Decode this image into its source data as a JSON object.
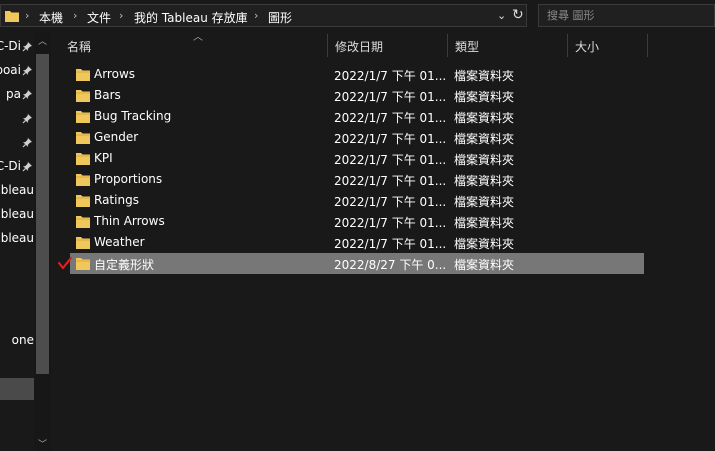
{
  "address": {
    "crumbs": [
      "本機",
      "文件",
      "我的 Tableau 存放庫",
      "圖形"
    ],
    "dropdown_glyph": "⌄",
    "refresh_glyph": "↻"
  },
  "search": {
    "placeholder": "搜尋 圖形"
  },
  "nav": {
    "items": [
      {
        "label": "C-Di",
        "pinned": true
      },
      {
        "label": "boai",
        "pinned": true
      },
      {
        "label": "pa",
        "pinned": true
      },
      {
        "label": "",
        "pinned": true
      },
      {
        "label": "",
        "pinned": true
      },
      {
        "label": "C-Di",
        "pinned": true
      },
      {
        "label": "ableau",
        "pinned": false
      },
      {
        "label": "ableau",
        "pinned": false
      },
      {
        "label": "ableau",
        "pinned": false
      },
      {
        "label": "one",
        "pinned": false
      }
    ]
  },
  "columns": {
    "name": "名稱",
    "date": "修改日期",
    "type": "類型",
    "size": "大小"
  },
  "files": [
    {
      "name": "Arrows",
      "date": "2022/1/7 下午 01...",
      "type": "檔案資料夾",
      "selected": false
    },
    {
      "name": "Bars",
      "date": "2022/1/7 下午 01...",
      "type": "檔案資料夾",
      "selected": false
    },
    {
      "name": "Bug Tracking",
      "date": "2022/1/7 下午 01...",
      "type": "檔案資料夾",
      "selected": false
    },
    {
      "name": "Gender",
      "date": "2022/1/7 下午 01...",
      "type": "檔案資料夾",
      "selected": false
    },
    {
      "name": "KPI",
      "date": "2022/1/7 下午 01...",
      "type": "檔案資料夾",
      "selected": false
    },
    {
      "name": "Proportions",
      "date": "2022/1/7 下午 01...",
      "type": "檔案資料夾",
      "selected": false
    },
    {
      "name": "Ratings",
      "date": "2022/1/7 下午 01...",
      "type": "檔案資料夾",
      "selected": false
    },
    {
      "name": "Thin Arrows",
      "date": "2022/1/7 下午 01...",
      "type": "檔案資料夾",
      "selected": false
    },
    {
      "name": "Weather",
      "date": "2022/1/7 下午 01...",
      "type": "檔案資料夾",
      "selected": false
    },
    {
      "name": "自定義形狀",
      "date": "2022/8/27 下午 0...",
      "type": "檔案資料夾",
      "selected": true
    }
  ],
  "colors": {
    "background": "#191919",
    "folder": "#f0c75a",
    "folder_dark": "#d9a83c",
    "selection": "#777777",
    "checkmark": "#e02020"
  }
}
